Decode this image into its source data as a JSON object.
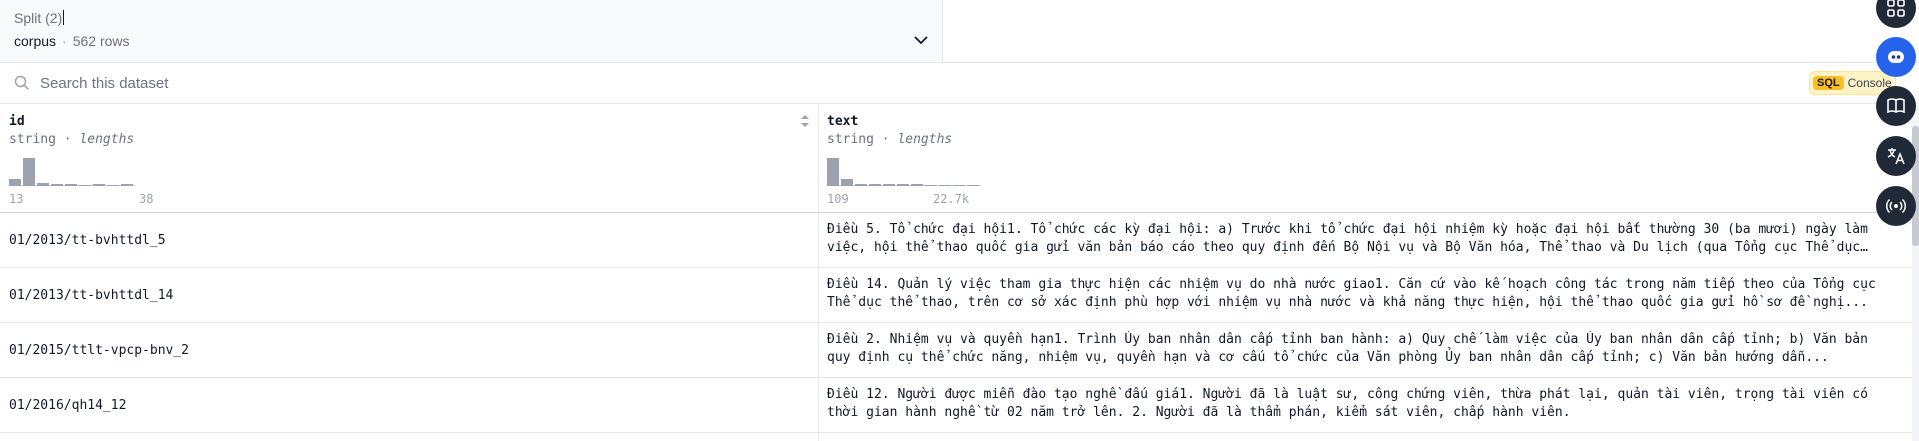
{
  "split": {
    "label": "Split (2)",
    "value": "corpus",
    "separator": "·",
    "rows": "562 rows"
  },
  "search": {
    "placeholder": "Search this dataset"
  },
  "sql_console": {
    "badge": "SQL",
    "label": "Console"
  },
  "columns": [
    {
      "name": "id",
      "type": "string",
      "stat": "lengths",
      "min": "13",
      "max": "38",
      "hist": [
        0.25,
        1.0,
        0.12,
        0.06,
        0.06,
        0.02,
        0.06,
        0.02,
        0.06
      ]
    },
    {
      "name": "text",
      "type": "string",
      "stat": "lengths",
      "min": "109",
      "max": "22.7k",
      "hist": [
        1.0,
        0.25,
        0.08,
        0.06,
        0.06,
        0.06,
        0.06,
        0.04,
        0.04,
        0.02,
        0.04
      ]
    }
  ],
  "rows": [
    {
      "id": "01/2013/tt-bvhttdl_5",
      "text": "Điều 5. Tổ chức đại hội1. Tổ chức các kỳ đại hội: a) Trước khi tổ chức đại hội nhiệm kỳ hoặc đại hội bất thường 30 (ba mươi) ngày làm việc, hội thể thao quốc gia gửi văn bản báo cáo theo quy định đến Bộ Nội vụ và Bộ Văn hóa, Thể thao và Du lịch (qua Tổng cục Thể dục thể thao)..."
    },
    {
      "id": "01/2013/tt-bvhttdl_14",
      "text": "Điều 14. Quản lý việc tham gia thực hiện các nhiệm vụ do nhà nước giao1. Căn cứ vào kế hoạch công tác trong năm tiếp theo của Tổng cục Thể dục thể thao, trên cơ sở xác định phù hợp với nhiệm vụ nhà nước và khả năng thực hiện, hội thể thao quốc gia gửi hồ sơ đề nghị..."
    },
    {
      "id": "01/2015/ttlt-vpcp-bnv_2",
      "text": "Điều 2. Nhiệm vụ và quyền hạn1. Trình Ủy ban nhân dân cấp tỉnh ban hành: a) Quy chế làm việc của Ủy ban nhân dân cấp tỉnh; b) Văn bản quy định cụ thể chức năng, nhiệm vụ, quyền hạn và cơ cấu tổ chức của Văn phòng Ủy ban nhân dân cấp tỉnh; c) Văn bản hướng dẫn..."
    },
    {
      "id": "01/2016/qh14_12",
      "text": "Điều 12. Người được miễn đào tạo nghề đấu giá1. Người đã là luật sư, công chứng viên, thừa phát lại, quản tài viên, trọng tài viên có thời gian hành nghề từ 02 năm trở lên. 2. Người đã là thẩm phán, kiểm sát viên, chấp hành viên."
    }
  ],
  "rail_icons": [
    "grid-icon",
    "bot-icon",
    "book-icon",
    "translate-icon",
    "broadcast-icon"
  ]
}
